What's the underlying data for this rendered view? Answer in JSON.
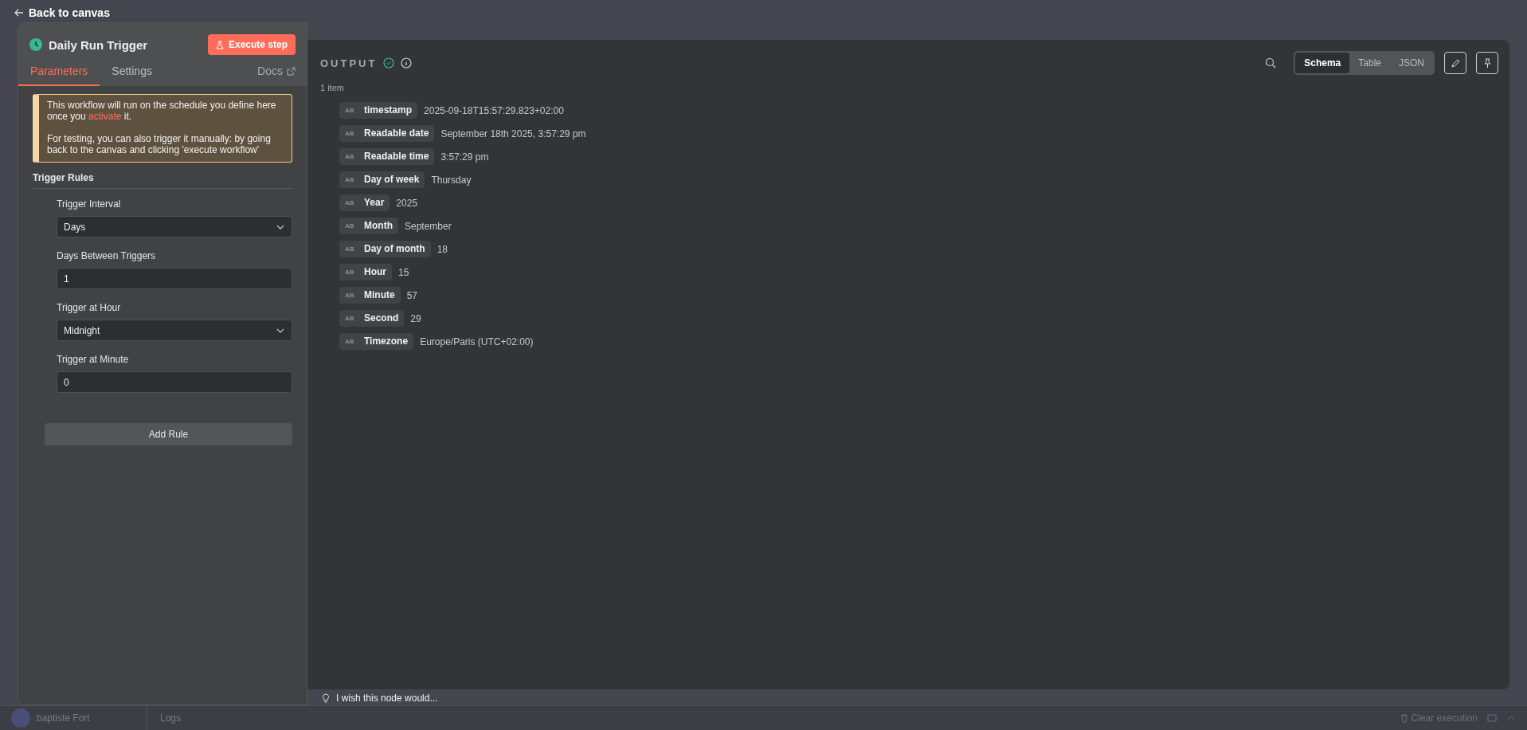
{
  "back_link": "Back to canvas",
  "node": {
    "title": "Daily Run Trigger",
    "execute_button": "Execute step",
    "tabs": [
      {
        "label": "Parameters",
        "selected": true
      },
      {
        "label": "Settings",
        "selected": false
      }
    ],
    "docs_link": "Docs",
    "notice": {
      "line1": "This workflow will run on the schedule you define here once you **activate** it.",
      "line2": "For testing, you can also trigger it manually: by going back to the canvas and clicking 'execute workflow'"
    },
    "section_title": "Trigger Rules",
    "fields": [
      {
        "label": "Trigger Interval",
        "kind": "select",
        "value": "Days"
      },
      {
        "label": "Days Between Triggers",
        "kind": "input",
        "value": "1"
      },
      {
        "label": "Trigger at Hour",
        "kind": "select",
        "value": "Midnight"
      },
      {
        "label": "Trigger at Minute",
        "kind": "input",
        "value": "0"
      }
    ],
    "add_button": "Add Rule"
  },
  "output": {
    "title": "OUTPUT",
    "count": "1 item",
    "views": [
      {
        "label": "Schema",
        "selected": true
      },
      {
        "label": "Table",
        "selected": false
      },
      {
        "label": "JSON",
        "selected": false
      }
    ],
    "items": [
      {
        "type": "AB",
        "key": "timestamp",
        "value": "2025-09-18T15:57:29.823+02:00"
      },
      {
        "type": "AB",
        "key": "Readable date",
        "value": "September 18th 2025, 3:57:29 pm"
      },
      {
        "type": "AB",
        "key": "Readable time",
        "value": "3:57:29 pm"
      },
      {
        "type": "AB",
        "key": "Day of week",
        "value": "Thursday"
      },
      {
        "type": "AB",
        "key": "Year",
        "value": "2025"
      },
      {
        "type": "AB",
        "key": "Month",
        "value": "September"
      },
      {
        "type": "AB",
        "key": "Day of month",
        "value": "18"
      },
      {
        "type": "AB",
        "key": "Hour",
        "value": "15"
      },
      {
        "type": "AB",
        "key": "Minute",
        "value": "57"
      },
      {
        "type": "AB",
        "key": "Second",
        "value": "29"
      },
      {
        "type": "AB",
        "key": "Timezone",
        "value": "Europe/Paris (UTC+02:00)"
      }
    ]
  },
  "feedback": "I wish this node would...",
  "bottom_bar": {
    "user": "baptiste Fort",
    "logs": "Logs",
    "clear": "Clear execution"
  }
}
